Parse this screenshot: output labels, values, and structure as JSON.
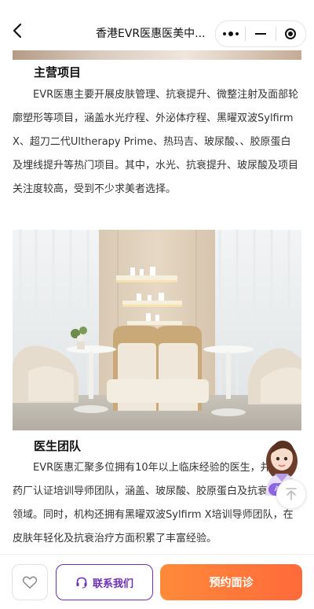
{
  "header": {
    "title": "香港EVR医惠医美中..."
  },
  "sections": [
    {
      "heading": "主营项目",
      "text": "EVR医惠主要开展皮肤管理、抗衰提升、微整注射及面部轮廓塑形等项目，涵盖水光疗程、外泌体疗程、黑曜双波Sylfirm X、超刀二代Ultherapy Prime、热玛吉、玻尿酸、、胶原蛋白及埋线提升等热门项目。其中，水光、抗衰提升、玻尿酸及项目关注度较高，受到不少求美者选择。"
    },
    {
      "heading": "医生团队",
      "text": "EVR医惠汇聚多位拥有10年以上临床经验的医生，并拥有药厂认证培训导师团队，涵盖、玻尿酸、胶原蛋白及抗衰提升等领域。同时，机构还拥有黑曜双波Sylfirm X培训导师团队，在皮肤年轻化及抗衰治疗方面积累了丰富经验。"
    }
  ],
  "ai_assistant": {
    "label": "AI助手"
  },
  "bottom_bar": {
    "contact_label": "联系我们",
    "book_label": "预约面诊"
  },
  "colors": {
    "accent_purple": "#6c2fb6",
    "accent_orange": "#ff7a3a"
  },
  "icons": {
    "back": "back-arrow-icon",
    "more": "more-dots-icon",
    "minimize": "minimize-icon",
    "close": "close-target-icon",
    "favorite": "heart-icon",
    "contact": "headset-icon",
    "scroll_top": "arrow-up-icon"
  }
}
